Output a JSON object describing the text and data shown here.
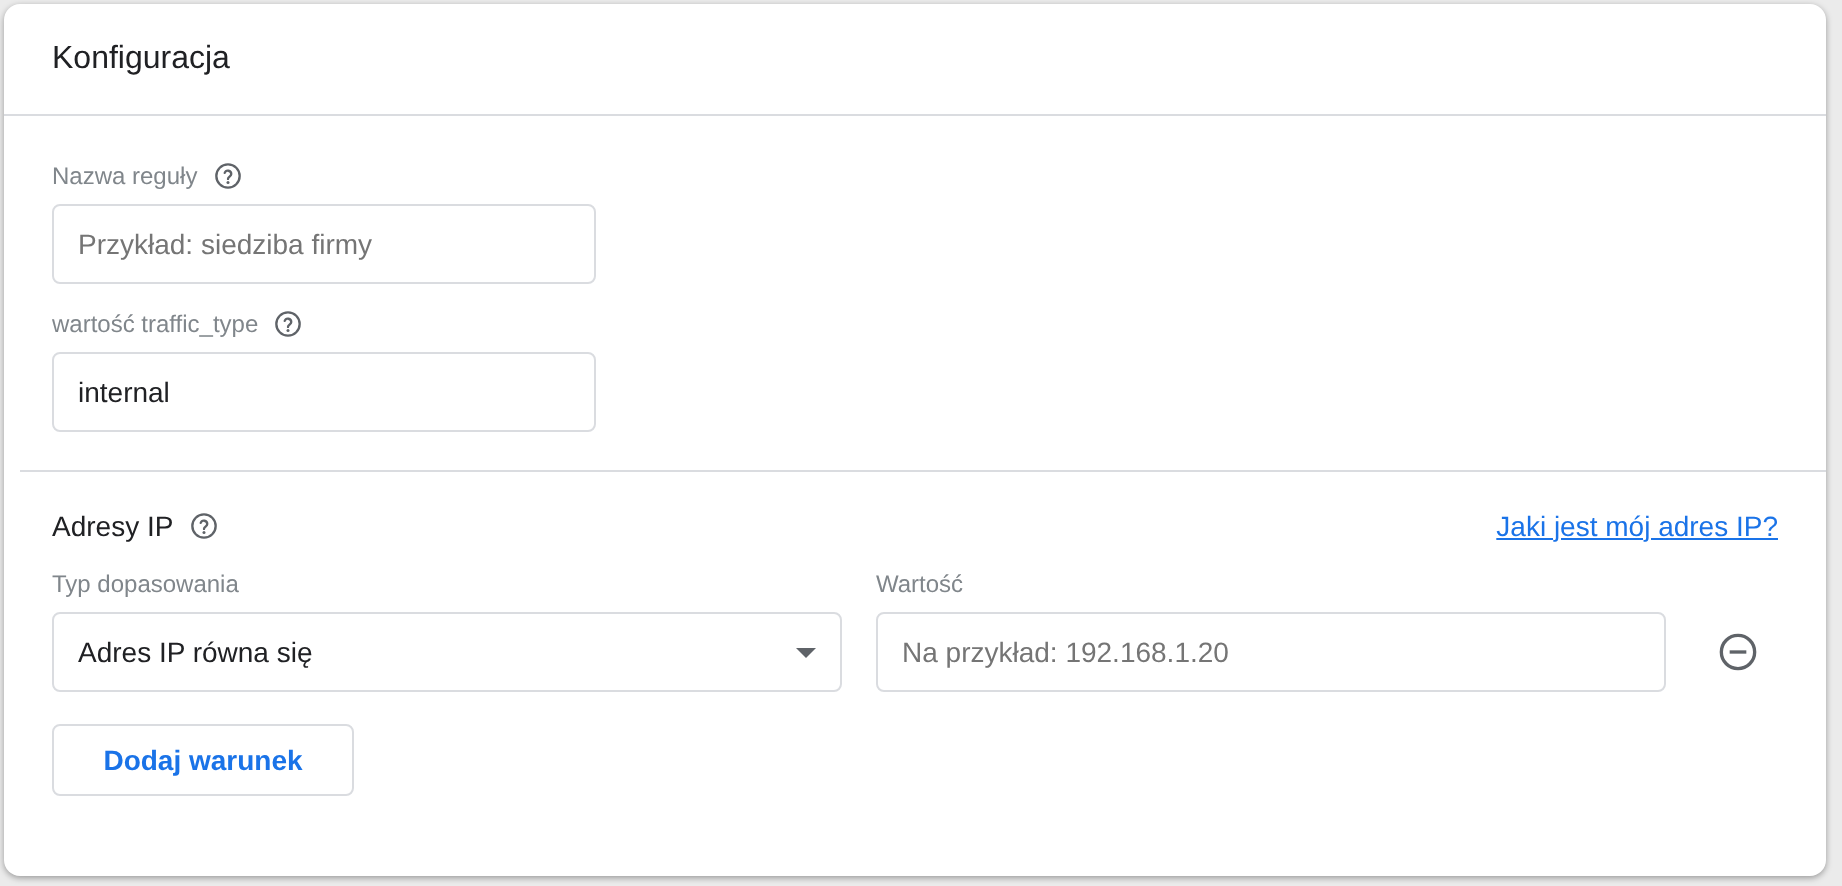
{
  "card": {
    "title": "Konfiguracja"
  },
  "fields": [
    {
      "label": "Nazwa reguły",
      "placeholder": "Przykład: siedziba firmy"
    },
    {
      "label": "wartość traffic_type",
      "value": "internal"
    }
  ],
  "ip_section": {
    "title": "Adresy IP",
    "link": "Jaki jest mój adres IP?",
    "conditions": [
      {
        "match_label": "Typ dopasowania",
        "match_value": "Adres IP równa się",
        "value_label": "Wartość",
        "value_placeholder": "Na przykład: 192.168.1.20"
      }
    ],
    "add_button": "Dodaj warunek"
  }
}
